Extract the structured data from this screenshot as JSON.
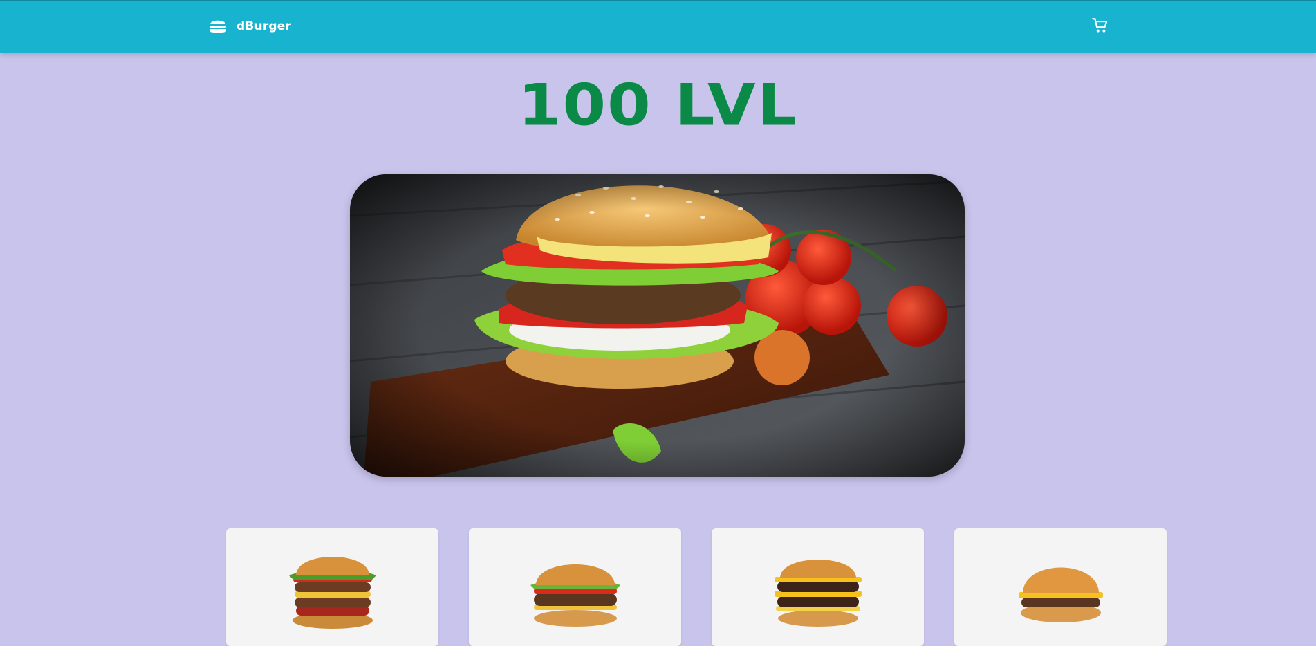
{
  "navbar": {
    "brand_icon": "burger-icon",
    "brand_name": "dBurger",
    "cart_icon": "shopping-cart-icon"
  },
  "hero": {
    "title": "100 LVL",
    "image": "burger-on-wooden-board-photo"
  },
  "colors": {
    "navbar_bg": "#17b3cf",
    "page_bg": "#c8c4ec",
    "title_color": "#0b8a47",
    "card_bg": "#f4f4f4"
  },
  "products": [
    {
      "image": "triple-bacon-burger-photo"
    },
    {
      "image": "classic-beef-burger-photo"
    },
    {
      "image": "double-cheeseburger-photo"
    },
    {
      "image": "cheeseburger-photo"
    }
  ]
}
